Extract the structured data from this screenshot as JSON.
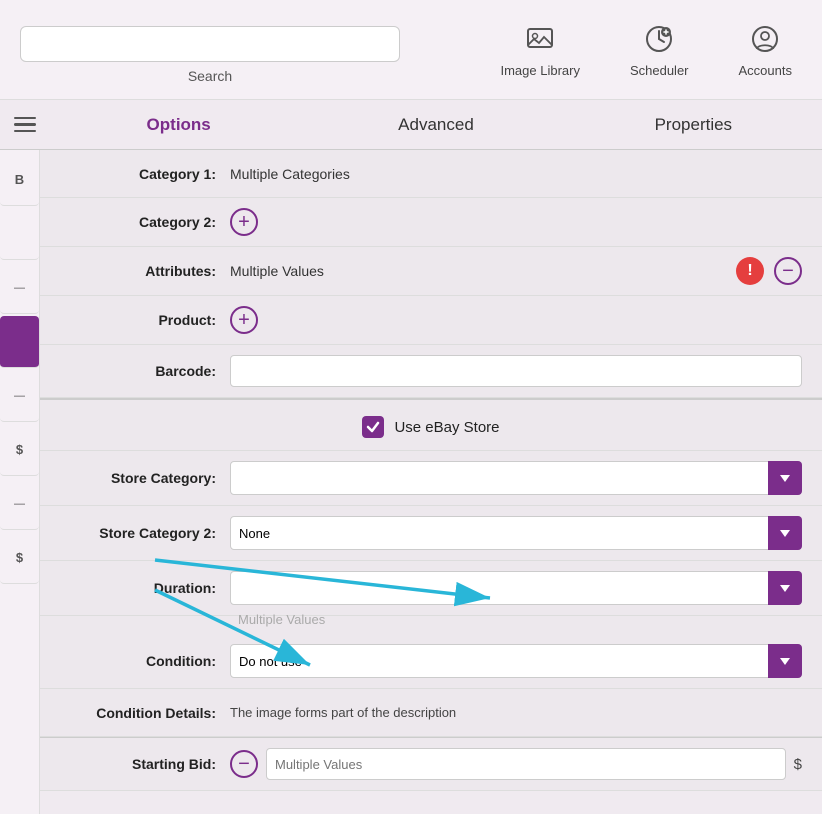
{
  "toolbar": {
    "search_placeholder": "",
    "search_label": "Search",
    "icons": [
      {
        "name": "image-library-icon",
        "label": "Image Library"
      },
      {
        "name": "scheduler-icon",
        "label": "Scheduler"
      },
      {
        "name": "accounts-icon",
        "label": "Accounts"
      }
    ]
  },
  "tabs": [
    {
      "id": "options",
      "label": "Options",
      "active": true
    },
    {
      "id": "advanced",
      "label": "Advanced",
      "active": false
    },
    {
      "id": "properties",
      "label": "Properties",
      "active": false
    }
  ],
  "form": {
    "category1_label": "Category 1:",
    "category1_value": "Multiple Categories",
    "category2_label": "Category 2:",
    "attributes_label": "Attributes:",
    "attributes_value": "Multiple Values",
    "product_label": "Product:",
    "barcode_label": "Barcode:",
    "ebay_store_label": "Use eBay Store",
    "store_category_label": "Store Category:",
    "store_category2_label": "Store Category 2:",
    "store_category2_value": "None",
    "duration_label": "Duration:",
    "duration_hint": "Multiple Values",
    "condition_label": "Condition:",
    "condition_value": "Do not use",
    "condition_details_label": "Condition Details:",
    "condition_details_value": "The image forms part of the description",
    "starting_bid_label": "Starting Bid:",
    "starting_bid_hint": "Multiple Values",
    "dollar_symbol": "$"
  },
  "sidebar": {
    "items": [
      {
        "label": "B",
        "active": false
      },
      {
        "label": "",
        "active": false
      },
      {
        "label": "—",
        "active": false
      },
      {
        "label": "",
        "active": true
      },
      {
        "label": "—",
        "active": false
      },
      {
        "label": "$",
        "active": false,
        "type": "dollar"
      },
      {
        "label": "—",
        "active": false
      },
      {
        "label": "$",
        "active": false,
        "type": "dollar"
      }
    ]
  }
}
